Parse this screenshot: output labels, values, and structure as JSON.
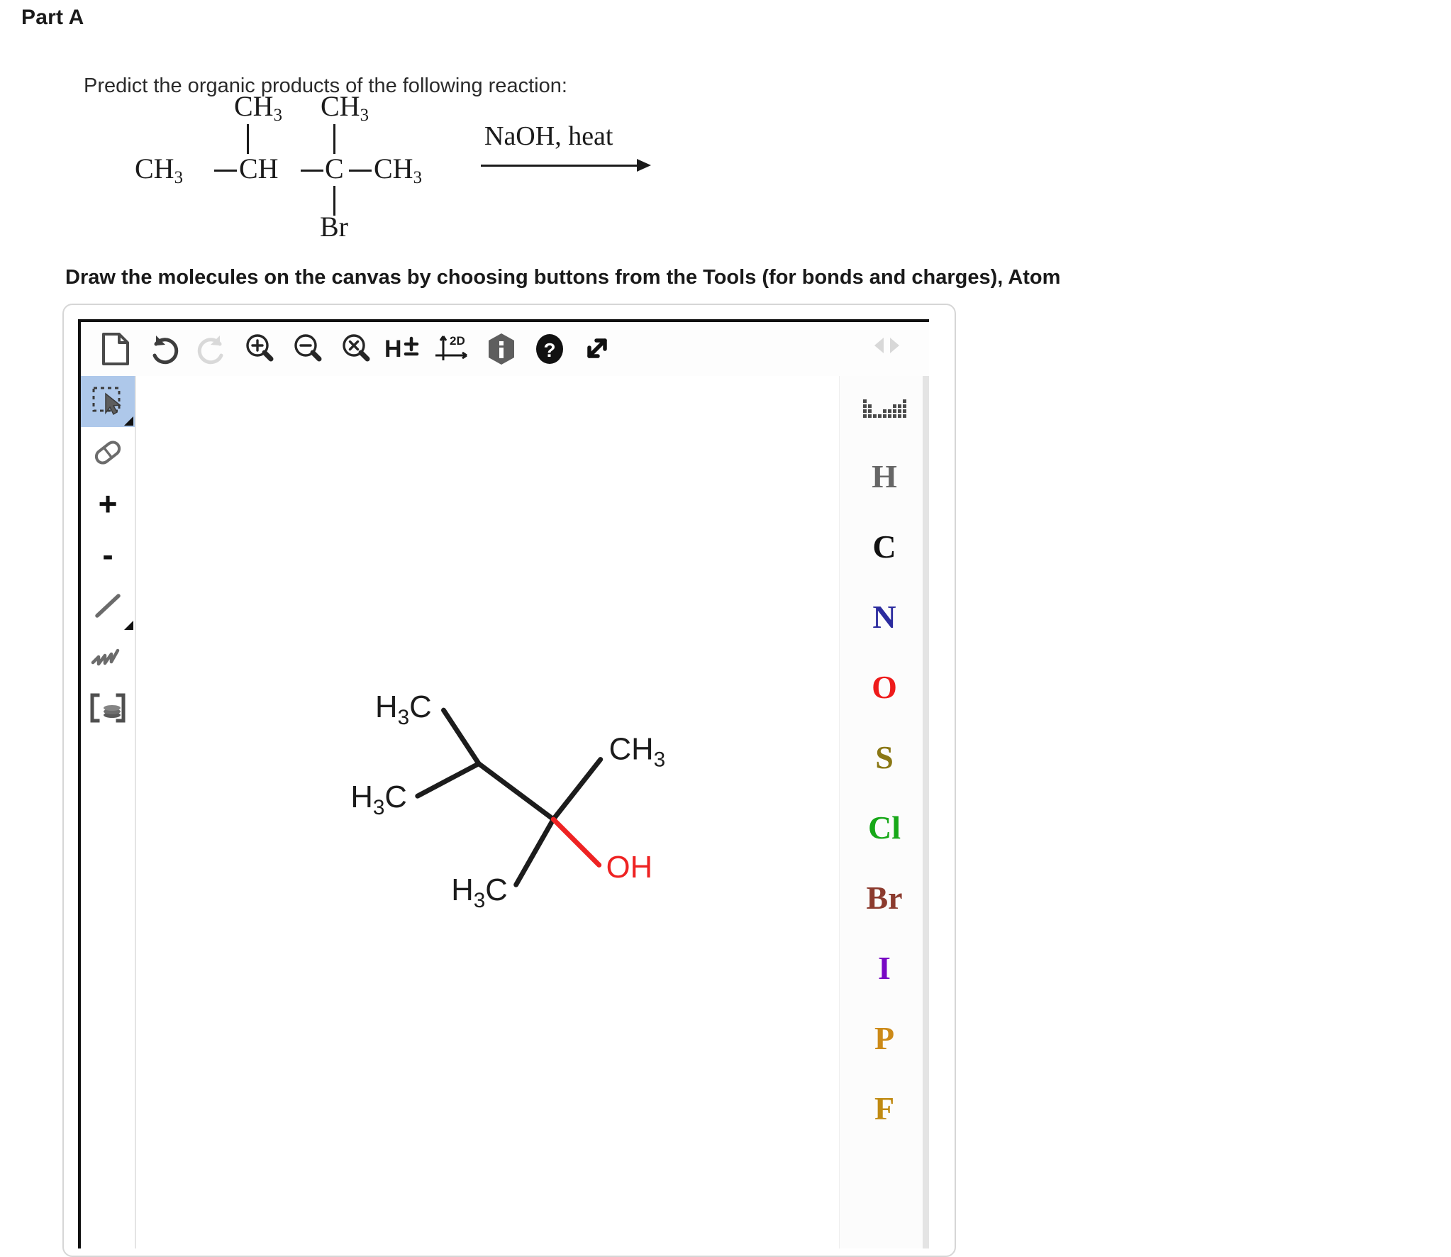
{
  "part": {
    "heading": "Part A",
    "prompt": "Predict the organic products of the following reaction:",
    "instruction": "Draw the molecules on the canvas by choosing buttons from the Tools (for bonds and charges), Atom"
  },
  "reaction": {
    "reagent": "NaOH, heat",
    "arrow": "reaction-arrow",
    "atoms": {
      "a1": "CH",
      "a1sub": "3",
      "a2": "CH",
      "a3": "C",
      "a4": "CH",
      "a4sub": "3",
      "top_left": "CH",
      "top_left_sub": "3",
      "top_right": "CH",
      "top_right_sub": "3",
      "bottom": "Br"
    }
  },
  "editor": {
    "toolbar": [
      {
        "name": "new-document-icon",
        "label": "New"
      },
      {
        "name": "undo-icon",
        "label": "Undo"
      },
      {
        "name": "redo-icon",
        "label": "Redo"
      },
      {
        "name": "zoom-in-icon",
        "label": "Zoom In"
      },
      {
        "name": "zoom-out-icon",
        "label": "Zoom Out"
      },
      {
        "name": "zoom-reset-icon",
        "label": "Reset Zoom"
      },
      {
        "name": "hydrogen-toggle-icon",
        "label": "H±"
      },
      {
        "name": "two-d-clean-icon",
        "label": "2D"
      },
      {
        "name": "info-icon",
        "label": "Info"
      },
      {
        "name": "help-icon",
        "label": "Help"
      },
      {
        "name": "fullscreen-icon",
        "label": "Fullscreen"
      }
    ],
    "nav": {
      "prev": "previous",
      "next": "next"
    },
    "tools": [
      {
        "name": "select-tool",
        "label": "Select",
        "active": true
      },
      {
        "name": "eraser-tool",
        "label": "Eraser",
        "active": false
      },
      {
        "name": "positive-charge-tool",
        "label": "+",
        "active": false
      },
      {
        "name": "negative-charge-tool",
        "label": "-",
        "active": false
      },
      {
        "name": "single-bond-tool",
        "label": "Single Bond",
        "active": false
      },
      {
        "name": "chain-tool",
        "label": "Chain",
        "active": false
      },
      {
        "name": "template-tool",
        "label": "Templates",
        "active": false
      }
    ],
    "elements": [
      {
        "symbol": "",
        "name": "periodic-table-button",
        "color": "#4a4a4a"
      },
      {
        "symbol": "H",
        "name": "element-h",
        "color": "#666666"
      },
      {
        "symbol": "C",
        "name": "element-c",
        "color": "#111111"
      },
      {
        "symbol": "N",
        "name": "element-n",
        "color": "#2b2b9e"
      },
      {
        "symbol": "O",
        "name": "element-o",
        "color": "#ee1b1b"
      },
      {
        "symbol": "S",
        "name": "element-s",
        "color": "#8a7714"
      },
      {
        "symbol": "Cl",
        "name": "element-cl",
        "color": "#17a818"
      },
      {
        "symbol": "Br",
        "name": "element-br",
        "color": "#8c3b2e"
      },
      {
        "symbol": "I",
        "name": "element-i",
        "color": "#7808c4"
      },
      {
        "symbol": "P",
        "name": "element-p",
        "color": "#cc8a18"
      },
      {
        "symbol": "F",
        "name": "element-f",
        "color": "#c08a12"
      }
    ],
    "canvas_molecule": {
      "name": "2,3-dimethylbutan-2-ol",
      "labels": [
        {
          "text": "H3C",
          "role": "methyl-top-left"
        },
        {
          "text": "H3C",
          "role": "methyl-left"
        },
        {
          "text": "CH3",
          "role": "methyl-right"
        },
        {
          "text": "H3C",
          "role": "methyl-bottom"
        },
        {
          "text": "OH",
          "role": "hydroxyl"
        }
      ],
      "bond_color": "#1c1c1c",
      "oxygen_color": "#ee2222"
    }
  }
}
